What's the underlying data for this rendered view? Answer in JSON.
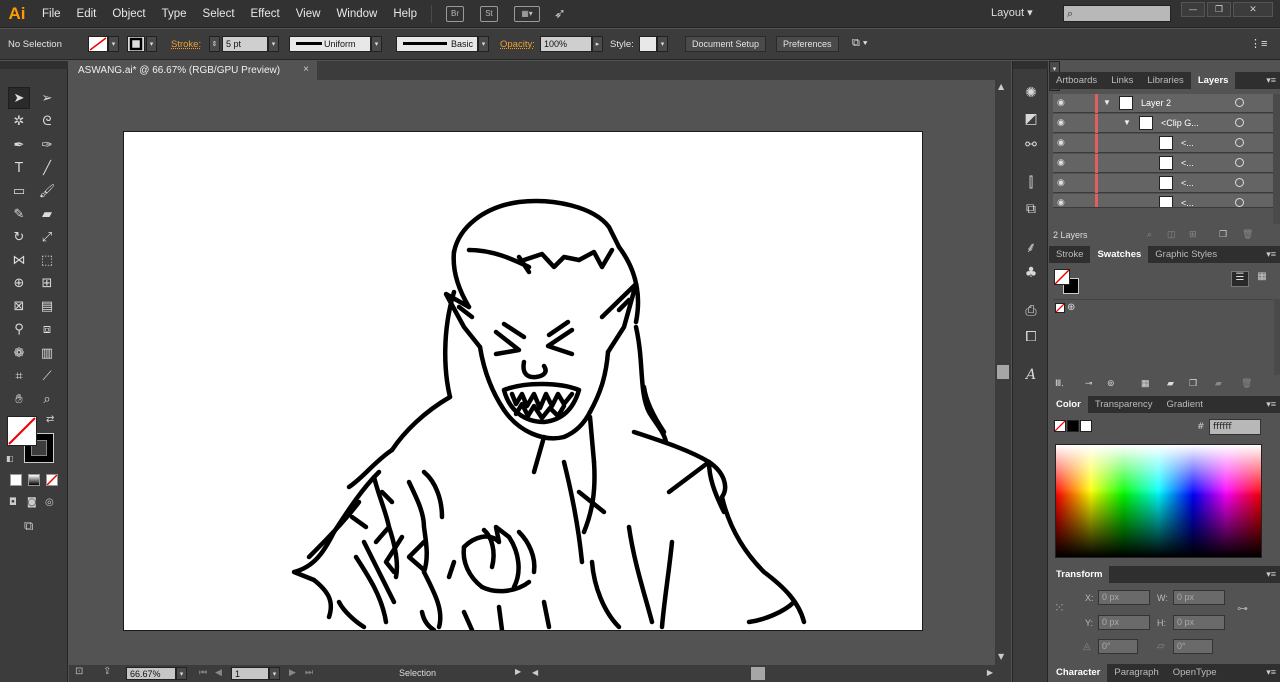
{
  "app": {
    "logo": "Ai"
  },
  "menus": [
    "File",
    "Edit",
    "Object",
    "Type",
    "Select",
    "Effect",
    "View",
    "Window",
    "Help"
  ],
  "menubar_icons": {
    "bridge": "Br",
    "stock": "St"
  },
  "workspace": {
    "label": "Layout ▾"
  },
  "control": {
    "selection": "No Selection",
    "stroke_label": "Stroke:",
    "stroke_weight": "5 pt",
    "profile_uniform": "Uniform",
    "brush_basic": "Basic",
    "opacity_label": "Opacity:",
    "opacity_value": "100%",
    "style_label": "Style:",
    "document_setup": "Document Setup",
    "preferences": "Preferences"
  },
  "document": {
    "tab_title": "ASWANG.ai* @ 66.67% (RGB/GPU Preview)",
    "close": "×"
  },
  "statusbar": {
    "zoom": "66.67%",
    "artboard": "1",
    "tool": "Selection"
  },
  "panels": {
    "layers_tabs": [
      "Artboards",
      "Links",
      "Libraries",
      "Layers"
    ],
    "layers": [
      {
        "name": "Layer 2"
      },
      {
        "name": "<Clip G..."
      },
      {
        "name": "<..."
      },
      {
        "name": "<..."
      },
      {
        "name": "<..."
      },
      {
        "name": "<..."
      }
    ],
    "layers_count": "2 Layers",
    "swatch_tabs": [
      "Stroke",
      "Swatches",
      "Graphic Styles"
    ],
    "color_tabs": [
      "Color",
      "Transparency",
      "Gradient"
    ],
    "color_hex_label": "#",
    "color_hex": "ffffff",
    "transform_title": "Transform",
    "transform": {
      "x_label": "X:",
      "x": "0 px",
      "y_label": "Y:",
      "y": "0 px",
      "w_label": "W:",
      "w": "0 px",
      "h_label": "H:",
      "h": "0 px",
      "rot": "0°",
      "shear": "0°"
    },
    "bottom_tabs": [
      "Character",
      "Paragraph",
      "OpenType"
    ]
  },
  "colors": {
    "chrome_dark": "#323232",
    "chrome": "#3c3c3c",
    "canvas_bg": "#535353",
    "accent_orange": "#f0a030",
    "layer_color": "#e06060"
  }
}
